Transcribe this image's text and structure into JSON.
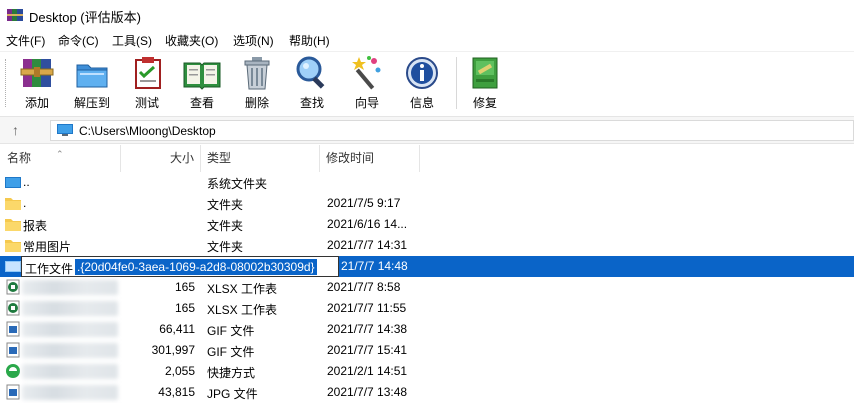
{
  "window": {
    "title": "Desktop (评估版本)"
  },
  "menu": [
    "文件(F)",
    "命令(C)",
    "工具(S)",
    "收藏夹(O)",
    "选项(N)",
    "帮助(H)"
  ],
  "toolbar": [
    {
      "label": "添加",
      "icon": "add-archive-icon"
    },
    {
      "label": "解压到",
      "icon": "extract-to-icon"
    },
    {
      "label": "测试",
      "icon": "test-icon"
    },
    {
      "label": "查看",
      "icon": "view-book-icon"
    },
    {
      "label": "删除",
      "icon": "trash-icon"
    },
    {
      "label": "查找",
      "icon": "magnifier-icon"
    },
    {
      "label": "向导",
      "icon": "wizard-wand-icon"
    },
    {
      "label": "信息",
      "icon": "info-icon"
    },
    {
      "label": "修复",
      "icon": "repair-kit-icon"
    }
  ],
  "address": {
    "path": "C:\\Users\\Mloong\\Desktop"
  },
  "columns": {
    "name": "名称",
    "size": "大小",
    "type": "类型",
    "modified": "修改时间"
  },
  "rows": [
    {
      "name": "..",
      "size": "",
      "type": "系统文件夹",
      "modified": "",
      "icon": "desktop-folder-icon"
    },
    {
      "name": ".",
      "size": "",
      "type": "文件夹",
      "modified": "2021/7/5 9:17",
      "icon": "folder-icon"
    },
    {
      "name": "报表",
      "size": "",
      "type": "文件夹",
      "modified": "2021/6/16 14...",
      "icon": "folder-icon"
    },
    {
      "name": "常用图片",
      "size": "",
      "type": "文件夹",
      "modified": "2021/7/7 14:31",
      "icon": "folder-icon"
    },
    {
      "name": "",
      "size": "",
      "type": "",
      "modified": "21/7/7 14:48",
      "icon": "desktop-folder-icon"
    },
    {
      "name": "",
      "size": "165",
      "type": "XLSX 工作表",
      "modified": "2021/7/7 8:58",
      "icon": "excel-file-icon"
    },
    {
      "name": "",
      "size": "165",
      "type": "XLSX 工作表",
      "modified": "2021/7/7 11:55",
      "icon": "excel-file-icon"
    },
    {
      "name": "",
      "size": "66,411",
      "type": "GIF 文件",
      "modified": "2021/7/7 14:38",
      "icon": "image-file-icon"
    },
    {
      "name": "",
      "size": "301,997",
      "type": "GIF 文件",
      "modified": "2021/7/7 15:41",
      "icon": "image-file-icon"
    },
    {
      "name": "",
      "size": "2,055",
      "type": "快捷方式",
      "modified": "2021/2/1 14:51",
      "icon": "shortcut-icon"
    },
    {
      "name": "",
      "size": "43,815",
      "type": "JPG 文件",
      "modified": "2021/7/7 13:48",
      "icon": "image-file-icon"
    }
  ],
  "rename": {
    "prefix": "工作文件",
    "selected": ".{20d04fe0-3aea-1069-a2d8-08002b30309d}"
  }
}
